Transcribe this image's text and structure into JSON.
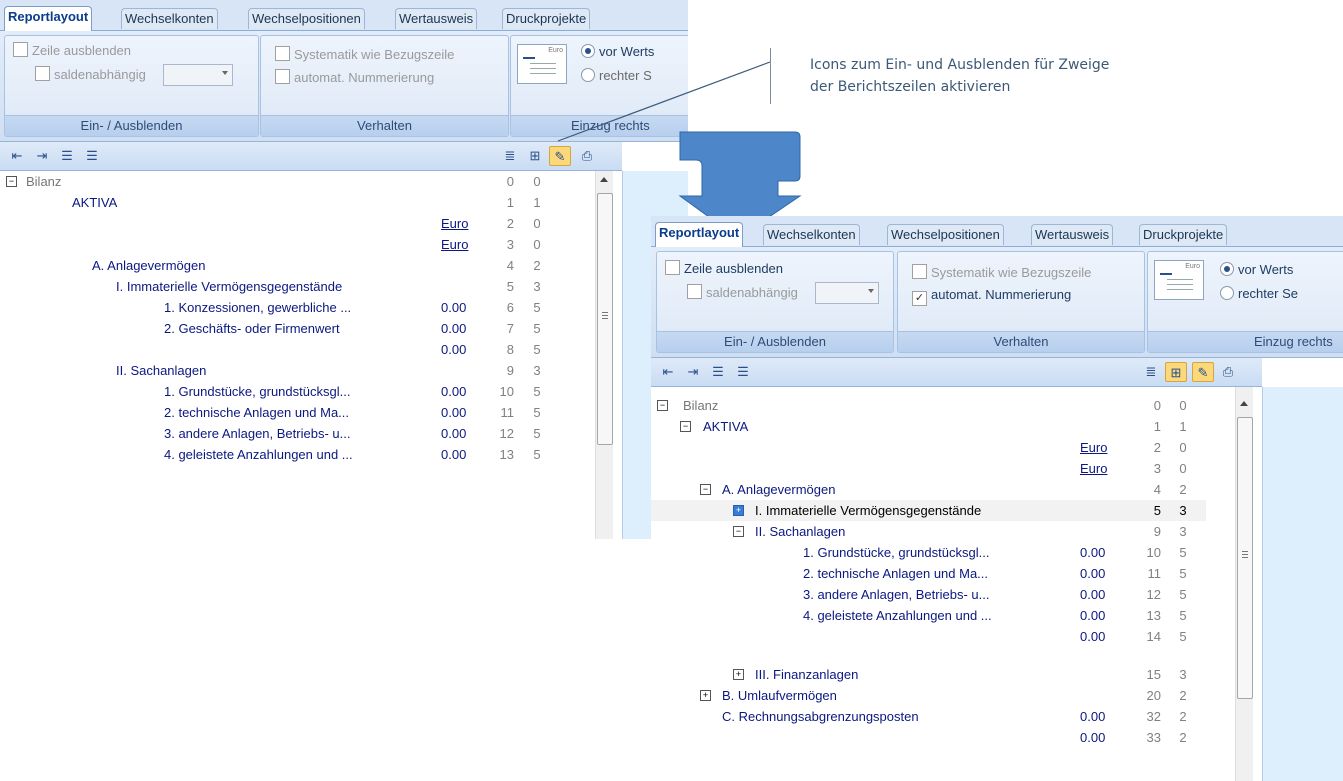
{
  "colors": {
    "tab_active": "#0a3c8c",
    "tree_text": "#0b1880",
    "ribbon": "#d7e5f6",
    "arrow": "#4d86c9",
    "highlight": "#fbd87a"
  },
  "tabs": [
    "Reportlayout",
    "Wechselkonten",
    "Wechselpositionen",
    "Wertausweis",
    "Druckprojekte"
  ],
  "callout": {
    "line1": "Icons zum Ein- und Ausblenden für Zweige",
    "line2": "der Berichtszeilen aktivieren"
  },
  "ribbon": {
    "hide_row": "Zeile ausblenden",
    "balance_dependent": "saldenabhängig",
    "group1": "Ein- / Ausblenden",
    "systematic": "Systematik wie Bezugszeile",
    "auto_numbering": "automat. Nummerierung",
    "group2": "Verhalten",
    "preview_currency": "Euro",
    "radio1_left": "vor Werts",
    "radio2_left": "rechter S",
    "group3_left": "Einzug rechts",
    "radio1_right": "vor Werts",
    "radio2_right": "rechter Se",
    "group3_right": "Einzug rechts"
  },
  "toolbar_icons": [
    "outdent-all-icon",
    "indent-all-icon",
    "outdent-icon",
    "indent-icon",
    "tree-view-icon",
    "tree-expand-icon",
    "properties-icon",
    "print-preview-icon"
  ],
  "tree_left": [
    {
      "label": "Bilanz",
      "val": "",
      "n1": "0",
      "n2": "0"
    },
    {
      "label": "AKTIVA",
      "val": "",
      "n1": "1",
      "n2": "1"
    },
    {
      "label": "",
      "val": "Euro",
      "n1": "2",
      "n2": "0"
    },
    {
      "label": "",
      "val": "Euro",
      "n1": "3",
      "n2": "0"
    },
    {
      "label": "A. Anlagevermögen",
      "val": "",
      "n1": "4",
      "n2": "2"
    },
    {
      "label": "I. Immaterielle Vermögensgegenstände",
      "val": "",
      "n1": "5",
      "n2": "3"
    },
    {
      "label": "1. Konzessionen, gewerbliche ...",
      "val": "0.00",
      "n1": "6",
      "n2": "5"
    },
    {
      "label": "2. Geschäfts- oder Firmenwert",
      "val": "0.00",
      "n1": "7",
      "n2": "5"
    },
    {
      "label": "",
      "val": "0.00",
      "n1": "8",
      "n2": "5"
    },
    {
      "label": "II. Sachanlagen",
      "val": "",
      "n1": "9",
      "n2": "3"
    },
    {
      "label": "1. Grundstücke, grundstücksgl...",
      "val": "0.00",
      "n1": "10",
      "n2": "5"
    },
    {
      "label": "2. technische Anlagen und Ma...",
      "val": "0.00",
      "n1": "11",
      "n2": "5"
    },
    {
      "label": "3. andere Anlagen, Betriebs- u...",
      "val": "0.00",
      "n1": "12",
      "n2": "5"
    },
    {
      "label": "4. geleistete Anzahlungen und ...",
      "val": "0.00",
      "n1": "13",
      "n2": "5"
    }
  ],
  "tree_right": [
    {
      "label": "Bilanz",
      "val": "",
      "n1": "0",
      "n2": "0"
    },
    {
      "label": "AKTIVA",
      "val": "",
      "n1": "1",
      "n2": "1"
    },
    {
      "label": "",
      "val": "Euro",
      "n1": "2",
      "n2": "0"
    },
    {
      "label": "",
      "val": "Euro",
      "n1": "3",
      "n2": "0"
    },
    {
      "label": "A. Anlagevermögen",
      "val": "",
      "n1": "4",
      "n2": "2"
    },
    {
      "label": "I. Immaterielle Vermögensgegenstände",
      "val": "",
      "n1": "5",
      "n2": "3"
    },
    {
      "label": "II. Sachanlagen",
      "val": "",
      "n1": "9",
      "n2": "3"
    },
    {
      "label": "1. Grundstücke, grundstücksgl...",
      "val": "0.00",
      "n1": "10",
      "n2": "5"
    },
    {
      "label": "2. technische Anlagen und Ma...",
      "val": "0.00",
      "n1": "11",
      "n2": "5"
    },
    {
      "label": "3. andere Anlagen, Betriebs- u...",
      "val": "0.00",
      "n1": "12",
      "n2": "5"
    },
    {
      "label": "4. geleistete Anzahlungen und ...",
      "val": "0.00",
      "n1": "13",
      "n2": "5"
    },
    {
      "label": "",
      "val": "0.00",
      "n1": "14",
      "n2": "5"
    },
    {
      "label": "III. Finanzanlagen",
      "val": "",
      "n1": "15",
      "n2": "3"
    },
    {
      "label": "B. Umlaufvermögen",
      "val": "",
      "n1": "20",
      "n2": "2"
    },
    {
      "label": "C. Rechnungsabgrenzungsposten",
      "val": "0.00",
      "n1": "32",
      "n2": "2"
    },
    {
      "label": "",
      "val": "0.00",
      "n1": "33",
      "n2": "2"
    }
  ]
}
